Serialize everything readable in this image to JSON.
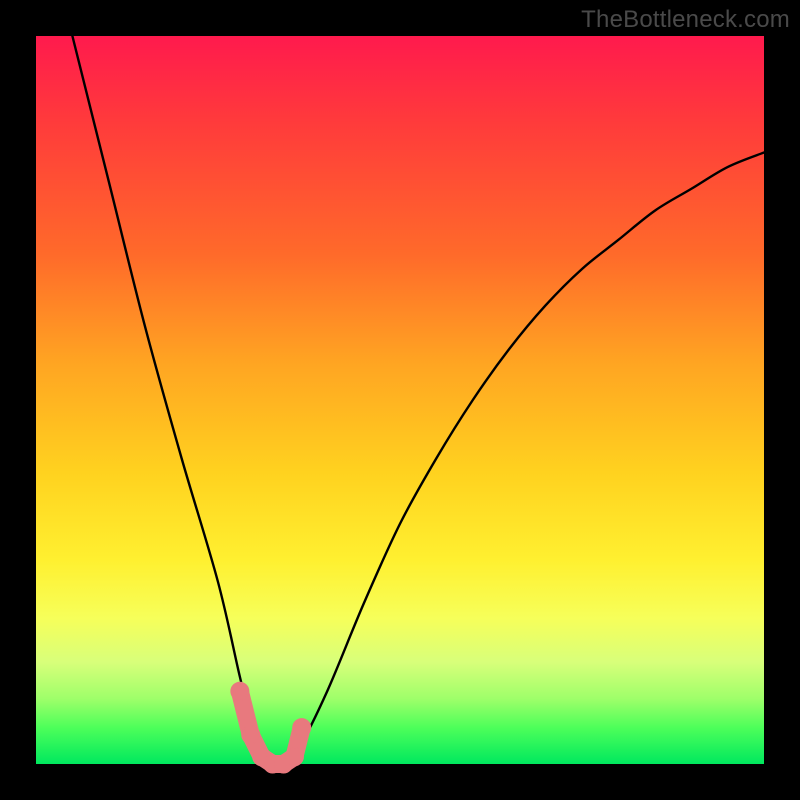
{
  "watermark": "TheBottleneck.com",
  "chart_data": {
    "type": "line",
    "title": "",
    "xlabel": "",
    "ylabel": "",
    "xlim": [
      0,
      100
    ],
    "ylim": [
      0,
      100
    ],
    "grid": false,
    "legend": false,
    "annotations": [],
    "series": [
      {
        "name": "bottleneck-curve",
        "x": [
          5,
          10,
          15,
          20,
          25,
          28,
          30,
          32,
          34,
          36,
          40,
          45,
          50,
          55,
          60,
          65,
          70,
          75,
          80,
          85,
          90,
          95,
          100
        ],
        "values": [
          100,
          80,
          60,
          42,
          25,
          12,
          4,
          0,
          0,
          2,
          10,
          22,
          33,
          42,
          50,
          57,
          63,
          68,
          72,
          76,
          79,
          82,
          84
        ]
      }
    ],
    "highlight": {
      "name": "bottom-marker",
      "x": [
        28,
        29.5,
        31,
        32.5,
        34,
        35.5,
        36.5
      ],
      "values": [
        10,
        4,
        1,
        0,
        0,
        1,
        5
      ]
    },
    "gradient_stops": [
      {
        "pos": 0.0,
        "color": "#ff1a4d"
      },
      {
        "pos": 0.12,
        "color": "#ff3b3b"
      },
      {
        "pos": 0.3,
        "color": "#ff6a2a"
      },
      {
        "pos": 0.45,
        "color": "#ffa522"
      },
      {
        "pos": 0.6,
        "color": "#ffd21f"
      },
      {
        "pos": 0.72,
        "color": "#fff030"
      },
      {
        "pos": 0.8,
        "color": "#f6ff5a"
      },
      {
        "pos": 0.86,
        "color": "#d8ff7a"
      },
      {
        "pos": 0.91,
        "color": "#9fff6a"
      },
      {
        "pos": 0.95,
        "color": "#4dff5a"
      },
      {
        "pos": 1.0,
        "color": "#00e85e"
      }
    ]
  }
}
